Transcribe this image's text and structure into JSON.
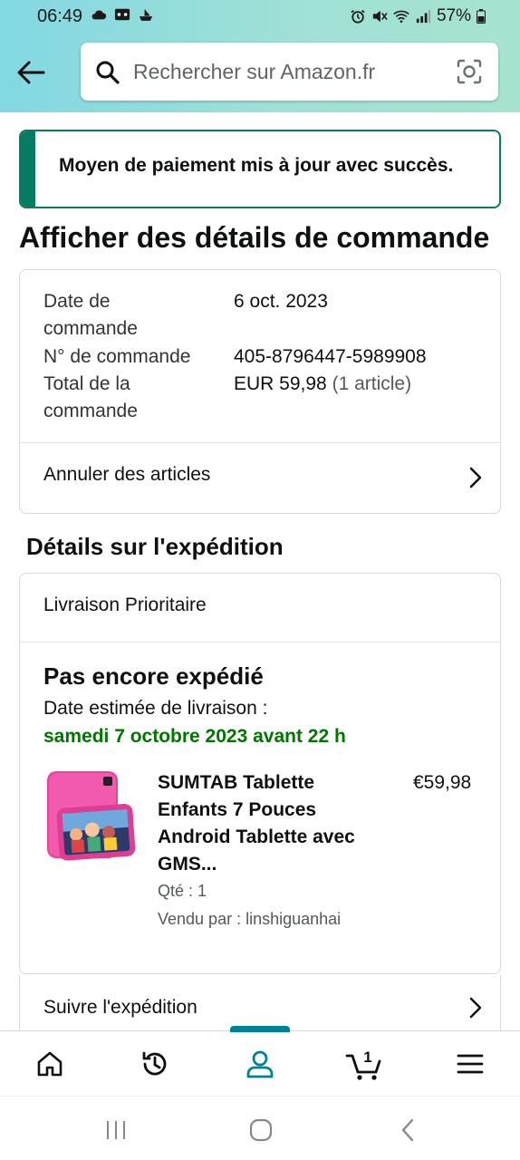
{
  "status_bar": {
    "time": "06:49",
    "battery": "57%"
  },
  "search": {
    "placeholder": "Rechercher sur Amazon.fr"
  },
  "alert": {
    "message": "Moyen de paiement mis à jour avec succès."
  },
  "page": {
    "title": "Afficher des détails de commande"
  },
  "order": {
    "date_label": "Date de commande",
    "date_value": "6 oct. 2023",
    "number_label": "N° de commande",
    "number_value": "405-8796447-5989908",
    "total_label": "Total de la commande",
    "total_value": "EUR 59,98",
    "total_items": "(1 article)",
    "cancel_label": "Annuler des articles"
  },
  "shipping": {
    "section_title": "Détails sur l'expédition",
    "type": "Livraison Prioritaire",
    "status": "Pas encore expédié",
    "eta_label": "Date estimée de livraison :",
    "eta_date": "samedi 7 octobre 2023 avant 22 h",
    "track_label": "Suivre l'expédition"
  },
  "product": {
    "title": "SUMTAB Tablette Enfants 7 Pouces Android Tablette avec GMS...",
    "price": "€59,98",
    "qty": "Qté : 1",
    "seller": "Vendu par : linshiguanhai"
  },
  "bottom_nav": {
    "cart_count": "1",
    "active": "profile",
    "accent_color": "#008296"
  },
  "colors": {
    "success": "#067d62",
    "eta_green": "#007600"
  }
}
